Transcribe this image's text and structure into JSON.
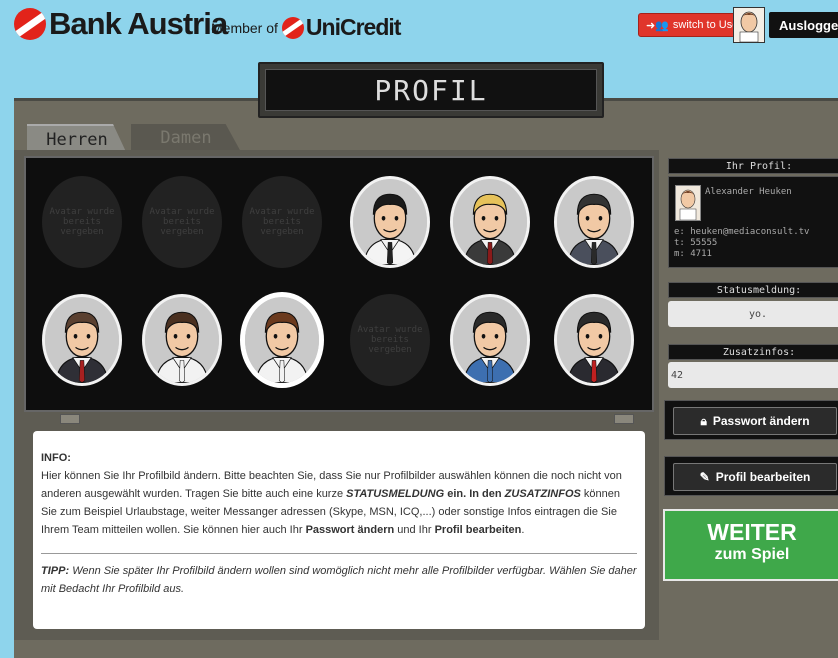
{
  "header": {
    "brand": "Bank Austria",
    "member_of": "Member of",
    "partner": "UniCredit",
    "switch_label": "switch to User",
    "logout_label": "Ausloggen"
  },
  "page": {
    "title": "PROFIL"
  },
  "tabs": [
    {
      "label": "Herren",
      "active": true
    },
    {
      "label": "Damen",
      "active": false
    }
  ],
  "avatars": [
    {
      "status": "taken",
      "label": "Avatar wurde bereits vergeben"
    },
    {
      "status": "taken",
      "label": "Avatar wurde bereits vergeben"
    },
    {
      "status": "taken",
      "label": "Avatar wurde bereits vergeben"
    },
    {
      "status": "available",
      "hair": "#1a1a1a",
      "shirt": "#f4f4f4",
      "tie": "#222222"
    },
    {
      "status": "available",
      "hair": "#e6c25a",
      "shirt": "#3a3a3a",
      "tie": "#8a1a1a"
    },
    {
      "status": "available",
      "hair": "#333333",
      "shirt": "#4a4f5c",
      "tie": "#2a2a2a"
    },
    {
      "status": "available",
      "hair": "#5a4030",
      "shirt": "#2f2f36",
      "tie": "#a82020"
    },
    {
      "status": "available",
      "hair": "#4a3020",
      "shirt": "#f2f2f2",
      "tie": "#f2f2f2"
    },
    {
      "status": "selected",
      "hair": "#6b3a1e",
      "shirt": "#f2f2f2",
      "tie": "#f2f2f2"
    },
    {
      "status": "taken",
      "label": "Avatar wurde bereits vergeben"
    },
    {
      "status": "available",
      "hair": "#2a2a2a",
      "shirt": "#3d6fb0",
      "tie": "#3d6fb0"
    },
    {
      "status": "available",
      "hair": "#2a2a2a",
      "shirt": "#2a2a30",
      "tie": "#c02020"
    }
  ],
  "info": {
    "heading": "INFO:",
    "p1": "Hier können Sie Ihr Profilbild ändern. Bitte beachten Sie, dass Sie nur Profilbilder auswählen können die noch nicht von anderen ausgewählt wurden. Tragen Sie bitte auch eine kurze",
    "status_keyword": "STATUSMELDUNG",
    "p2": "ein. In den",
    "zusatz_keyword": "ZUSATZINFOS",
    "p3": "können Sie zum Beispiel Urlaubstage, weiter Messanger adressen (Skype, MSN, ICQ,...) oder sonstige Infos eintragen die Sie Ihrem Team mitteilen wollen. Sie können hier auch Ihr",
    "passwort_keyword": "Passwort ändern",
    "p4": "und Ihr",
    "profil_keyword": "Profil bearbeiten",
    "p5": ".",
    "tipp_label": "TIPP:",
    "tipp_text": "Wenn Sie später Ihr Profilbild ändern wollen sind womöglich nicht mehr alle Profilbilder verfügbar. Wählen Sie daher mit Bedacht Ihr Profilbild aus."
  },
  "profile": {
    "label": "Ihr Profil:",
    "name": "Alexander Heuken",
    "email": "e: heuken@mediaconsult.tv",
    "phone": "t: 55555",
    "mobile": "m: 4711"
  },
  "status": {
    "label": "Statusmeldung:",
    "value": "yo."
  },
  "extra": {
    "label": "Zusatzinfos:",
    "value": "42"
  },
  "actions": {
    "password": "Passwort ändern",
    "edit_profile": "Profil bearbeiten"
  },
  "weiter": {
    "line1": "WEITER",
    "line2": "zum Spiel"
  },
  "colors": {
    "background": "#8ed4ec",
    "brand_red": "#e2231a",
    "go_green": "#3fa84a",
    "frame": "#6e6b5f"
  }
}
